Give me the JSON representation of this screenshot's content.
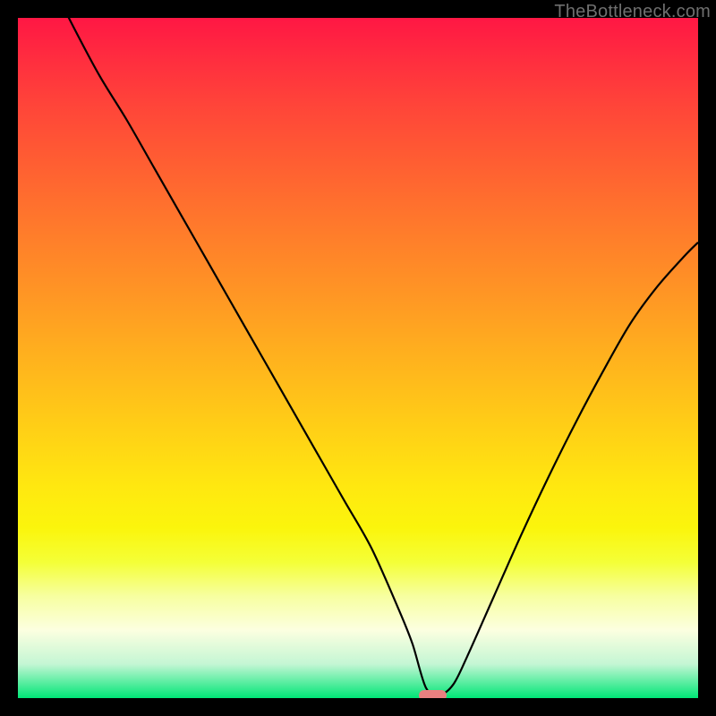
{
  "watermark": "TheBottleneck.com",
  "colors": {
    "background": "#000000",
    "curve": "#000000",
    "marker": "#e98080"
  },
  "chart_data": {
    "type": "line",
    "title": "",
    "xlabel": "",
    "ylabel": "",
    "xlim": [
      0,
      100
    ],
    "ylim": [
      0,
      100
    ],
    "grid": false,
    "legend": false,
    "optimum_x": 61,
    "marker": {
      "x_start": 59,
      "x_end": 63,
      "y": 0
    },
    "series": [
      {
        "name": "bottleneck-percent",
        "x": [
          0,
          4,
          8,
          12,
          16,
          20,
          24,
          28,
          32,
          36,
          40,
          44,
          48,
          52,
          56,
          58,
          60,
          62,
          64,
          66,
          70,
          74,
          78,
          82,
          86,
          90,
          94,
          98,
          100
        ],
        "y": [
          115,
          107,
          99,
          91.5,
          85,
          78,
          71,
          64,
          57,
          50,
          43,
          36,
          29,
          22,
          13,
          8,
          1.5,
          0.5,
          2,
          6,
          15,
          24,
          32.5,
          40.5,
          48,
          55,
          60.5,
          65,
          67
        ]
      }
    ]
  }
}
